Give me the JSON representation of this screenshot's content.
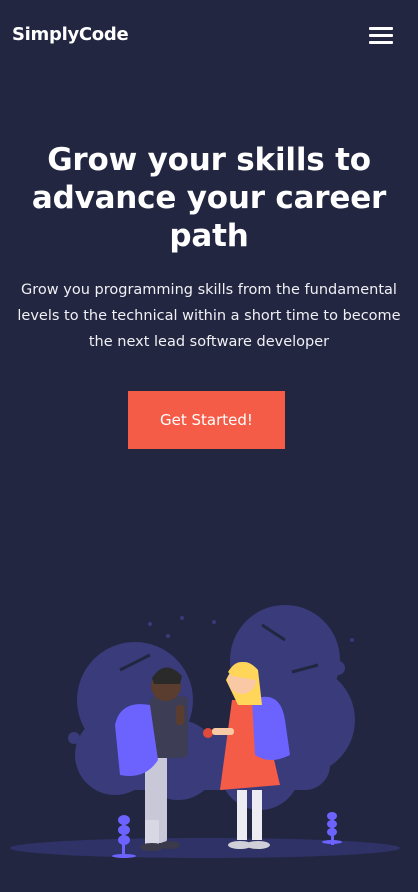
{
  "nav": {
    "logo": "SimplyCode",
    "menu_icon": "hamburger-menu-icon"
  },
  "hero": {
    "title": "Grow your skills to advance your career path",
    "subtitle": "Grow you programming skills from the fundamental levels to the technical within a short time to become the next lead software developer",
    "cta_label": "Get Started!"
  },
  "illustration": {
    "icon": "students-with-backpacks-illustration"
  },
  "colors": {
    "background": "#222640",
    "accent": "#f55c47",
    "illustration_purple": "#6c63ff",
    "illustration_shape": "#393b7a"
  }
}
